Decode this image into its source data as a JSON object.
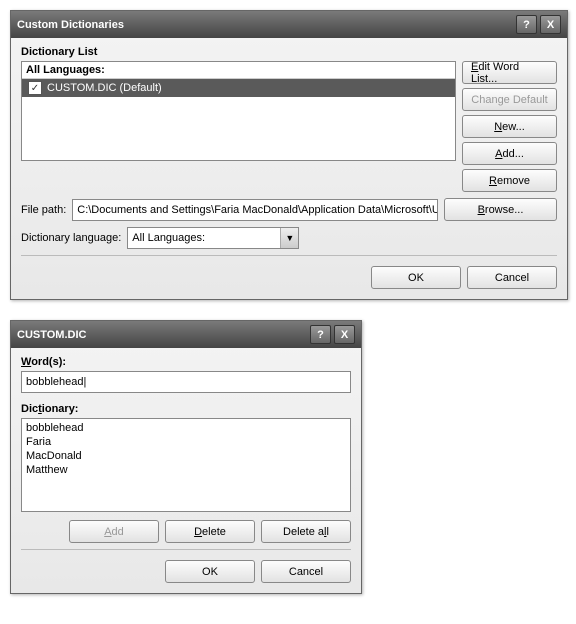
{
  "dialog1": {
    "title": "Custom Dictionaries",
    "help_icon": "?",
    "close_icon": "X",
    "section_label": "Dictionary List",
    "list_header": "All Languages:",
    "item_label": "CUSTOM.DIC (Default)",
    "buttons": {
      "edit": "Edit Word List...",
      "change_default": "Change Default",
      "new": "New...",
      "add": "Add...",
      "remove": "Remove",
      "browse": "Browse..."
    },
    "filepath_label": "File path:",
    "filepath_value": "C:\\Documents and Settings\\Faria MacDonald\\Application Data\\Microsoft\\UProof",
    "lang_label": "Dictionary language:",
    "lang_value": "All Languages:",
    "ok": "OK",
    "cancel": "Cancel"
  },
  "dialog2": {
    "title": "CUSTOM.DIC",
    "help_icon": "?",
    "close_icon": "X",
    "words_label": "Word(s):",
    "word_value": "bobblehead",
    "dict_label": "Dictionary:",
    "entries": [
      "bobblehead",
      "Faria",
      "MacDonald",
      "Matthew"
    ],
    "add": "Add",
    "delete": "Delete",
    "delete_all": "Delete all",
    "ok": "OK",
    "cancel": "Cancel"
  }
}
